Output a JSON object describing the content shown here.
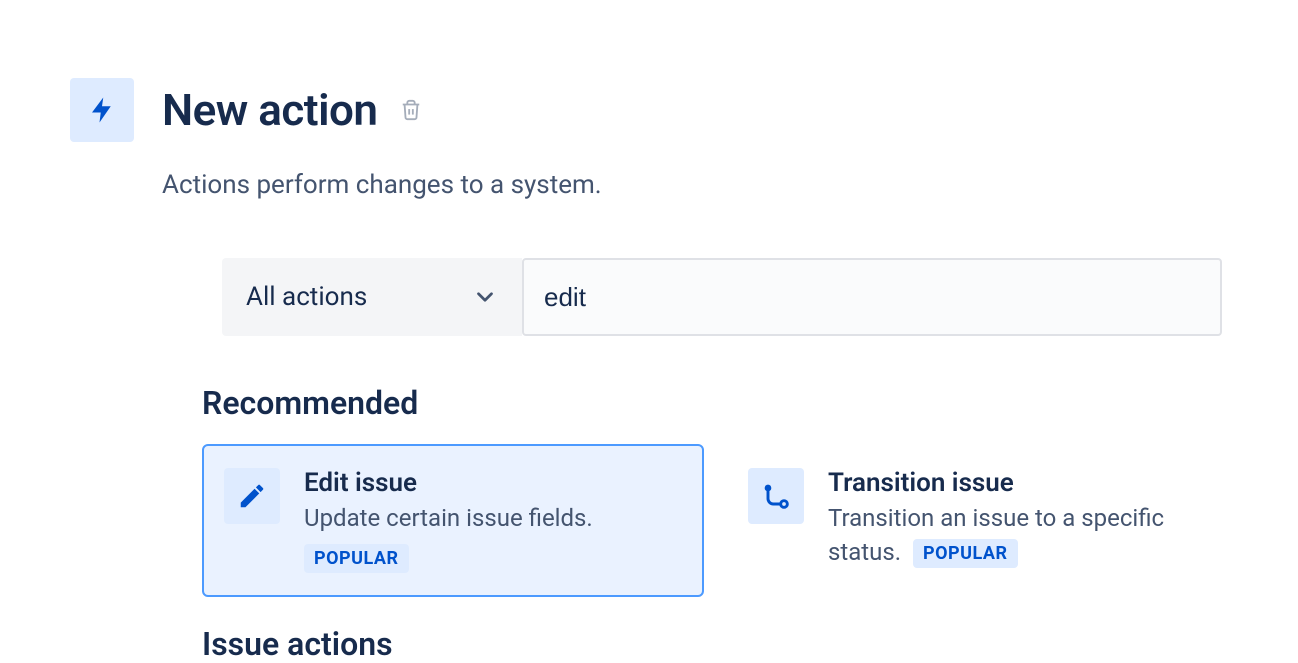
{
  "header": {
    "title": "New action",
    "subtitle": "Actions perform changes to a system."
  },
  "filter": {
    "dropdown_label": "All actions",
    "search_value": "edit"
  },
  "sections": {
    "recommended": {
      "title": "Recommended",
      "cards": [
        {
          "title": "Edit issue",
          "desc": "Update certain issue fields.",
          "badge": "POPULAR"
        },
        {
          "title": "Transition issue",
          "desc": "Transition an issue to a specific status.",
          "badge": "POPULAR"
        }
      ]
    },
    "issue_actions": {
      "title": "Issue actions"
    }
  }
}
